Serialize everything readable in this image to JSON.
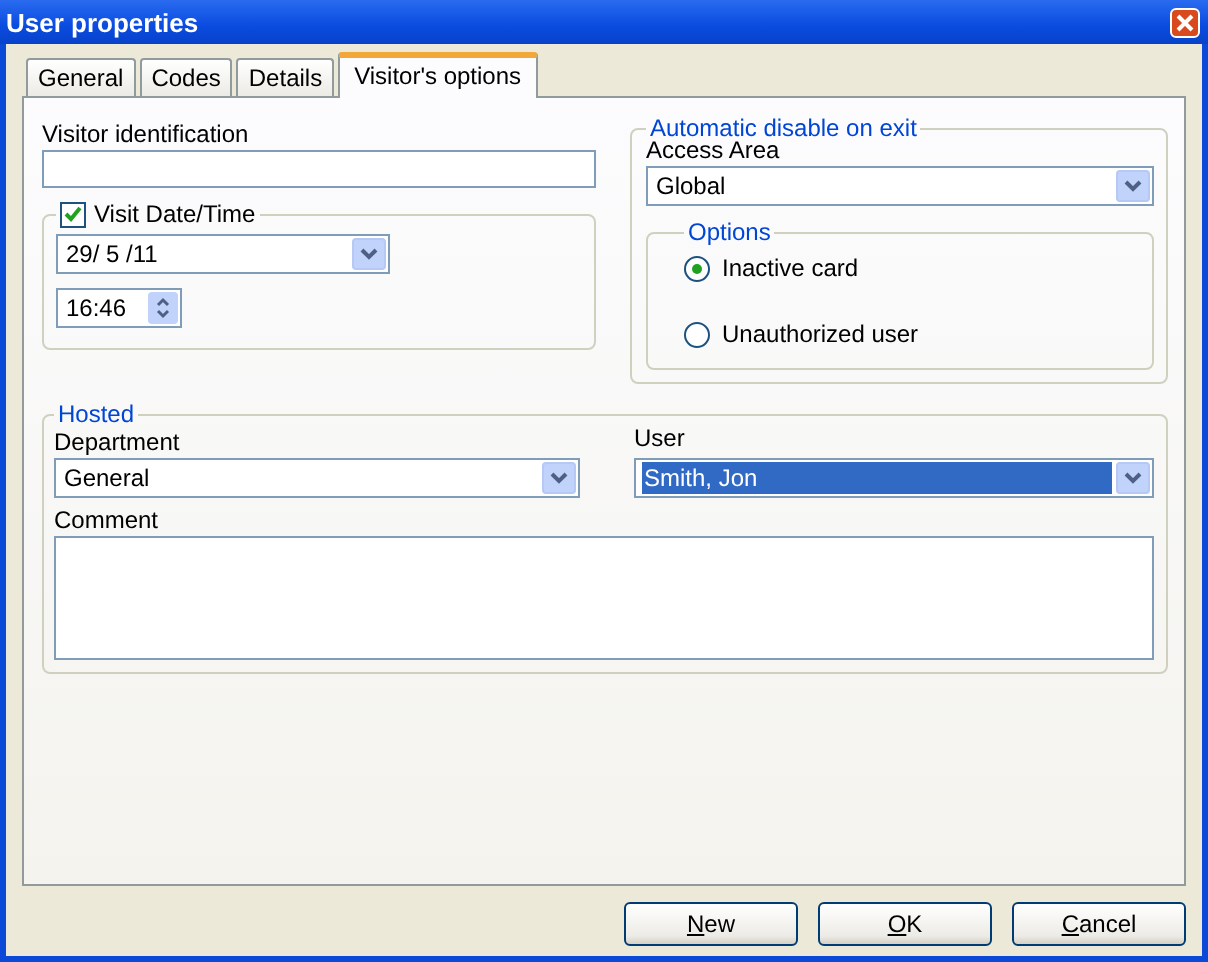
{
  "window": {
    "title": "User properties"
  },
  "tabs": [
    {
      "label": "General",
      "selected": false
    },
    {
      "label": "Codes",
      "selected": false
    },
    {
      "label": "Details",
      "selected": false
    },
    {
      "label": "Visitor's options",
      "selected": true
    }
  ],
  "visitor_identification": {
    "label": "Visitor identification"
  },
  "visit_datetime": {
    "label": "Visit Date/Time",
    "checked": true,
    "date": "29/ 5 /11",
    "time": "16:46"
  },
  "automatic_disable": {
    "title": "Automatic disable on exit",
    "access_area_label": "Access Area",
    "access_area": "Global",
    "options": {
      "title": "Options",
      "items": [
        {
          "label": "Inactive card",
          "selected": true
        },
        {
          "label": "Unauthorized user",
          "selected": false
        }
      ]
    }
  },
  "hosted": {
    "title": "Hosted",
    "department_label": "Department",
    "department": "General",
    "user_label": "User",
    "user": "Smith, Jon",
    "user_focused": true,
    "comment_label": "Comment"
  },
  "buttons": [
    "New",
    "OK",
    "Cancel"
  ]
}
